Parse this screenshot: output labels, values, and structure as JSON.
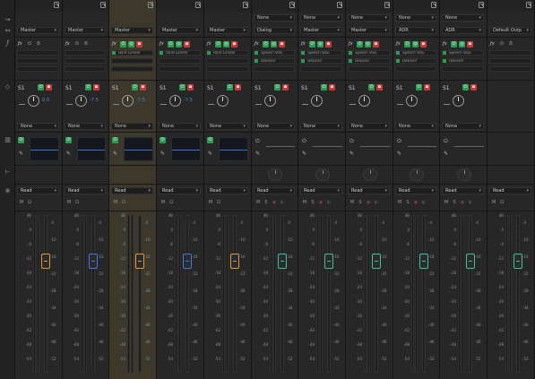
{
  "colors": {
    "fader_orange": "#e0983a",
    "fader_blue": "#3f78e0",
    "fader_teal": "#3ec0a2",
    "button_green": "#2e9b55",
    "button_red": "#c23a3a",
    "send_value_blue": "#3f8fe0"
  },
  "gutter_icons": [
    "input-routing-icon",
    "output-routing-icon",
    "fx-icon",
    "send-icon",
    "eq-icon",
    "pan-icon",
    "automation-icon"
  ],
  "scale_ticks": [
    "dB",
    "0",
    "-6",
    "-12",
    "-18",
    "-24",
    "-30",
    "-36",
    "-42",
    "-48",
    "-54"
  ],
  "right_ticks": [
    "-4",
    "-10",
    "-16",
    "-22",
    "-28",
    "-34",
    "-40",
    "-46",
    "-52"
  ],
  "strips": [
    {
      "input": "",
      "output": "Master",
      "fx": [],
      "send": "S1",
      "send_val": "0.0",
      "dest": "None",
      "eq": true,
      "automation": "Read",
      "fader": "orange",
      "selected": false
    },
    {
      "input": "",
      "output": "Master",
      "fx": [],
      "send": "S1",
      "send_val": "-7.5",
      "dest": "None",
      "eq": true,
      "automation": "Read",
      "fader": "blue",
      "selected": false
    },
    {
      "input": "",
      "output": "Master",
      "fx": [
        "Hard Limiter"
      ],
      "send": "S1",
      "send_val": "-7.5",
      "dest": "None",
      "eq": true,
      "automation": "Read",
      "fader": "orange",
      "selected": true
    },
    {
      "input": "",
      "output": "Master",
      "fx": [
        "Hard Limiter"
      ],
      "send": "S1",
      "send_val": "-7.5",
      "dest": "None",
      "eq": true,
      "automation": "Read",
      "fader": "blue",
      "selected": false
    },
    {
      "input": "",
      "output": "Master",
      "fx": [
        "Hard Limiter"
      ],
      "send": "S1",
      "send_val": "",
      "dest": "None",
      "eq": true,
      "automation": "Read",
      "fader": "orange",
      "selected": false
    },
    {
      "input": "None",
      "output": "Dialog",
      "fx": [
        "Speech Volu",
        "DeEsser"
      ],
      "send": "S1",
      "send_val": "",
      "dest": "None",
      "eq": false,
      "automation": "Read",
      "fader": "teal",
      "selected": false
    },
    {
      "input": "None",
      "output": "Master",
      "fx": [
        "Speech Volu",
        "DeEsser"
      ],
      "send": "S1",
      "send_val": "",
      "dest": "None",
      "eq": false,
      "automation": "Read",
      "fader": "teal",
      "selected": false
    },
    {
      "input": "None",
      "output": "Master",
      "fx": [
        "Speech Volu",
        "DeEsser"
      ],
      "send": "S1",
      "send_val": "",
      "dest": "None",
      "eq": false,
      "automation": "Read",
      "fader": "teal",
      "selected": false
    },
    {
      "input": "None",
      "output": "ADR",
      "fx": [
        "Speech Volu",
        "DeEsser"
      ],
      "send": "S1",
      "send_val": "",
      "dest": "None",
      "eq": false,
      "automation": "Read",
      "fader": "teal",
      "selected": false
    },
    {
      "input": "None",
      "output": "ADR",
      "fx": [
        "Speech Volu",
        "DeEsser"
      ],
      "send": "S1",
      "send_val": "",
      "dest": "None",
      "eq": false,
      "automation": "Read",
      "fader": "teal",
      "selected": false
    },
    {
      "input": "",
      "output": "Default Outp",
      "fx": [],
      "send": "",
      "send_val": "",
      "dest": "",
      "eq": false,
      "automation": "Read",
      "fader": "teal",
      "selected": false
    }
  ]
}
